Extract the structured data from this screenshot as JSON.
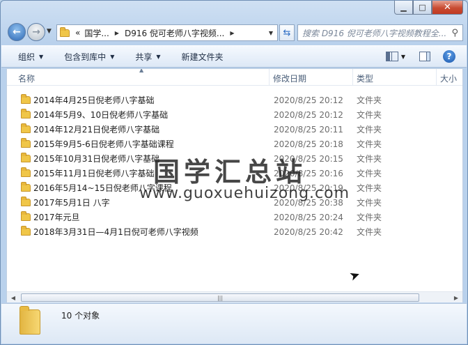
{
  "address": {
    "overflow": "«",
    "crumbs": [
      "国学...",
      "D916 倪可老师八字视频..."
    ]
  },
  "search": {
    "placeholder": "搜索 D916 倪可老师八字视频教程全..."
  },
  "toolbar": {
    "organize": "组织",
    "include_library": "包含到库中",
    "share": "共享",
    "new_folder": "新建文件夹"
  },
  "columns": {
    "name": "名称",
    "date": "修改日期",
    "type": "类型",
    "size": "大小"
  },
  "files": [
    {
      "name": "2014年4月25日倪老师八字基础",
      "date": "2020/8/25 20:12",
      "type": "文件夹"
    },
    {
      "name": "2014年5月9、10日倪老师八字基础",
      "date": "2020/8/25 20:12",
      "type": "文件夹"
    },
    {
      "name": "2014年12月21日倪老师八字基础",
      "date": "2020/8/25 20:11",
      "type": "文件夹"
    },
    {
      "name": "2015年9月5-6日倪老师八字基础课程",
      "date": "2020/8/25 20:18",
      "type": "文件夹"
    },
    {
      "name": "2015年10月31日倪老师八字基础",
      "date": "2020/8/25 20:15",
      "type": "文件夹"
    },
    {
      "name": "2015年11月1日倪老师八字基础",
      "date": "2020/8/25 20:16",
      "type": "文件夹"
    },
    {
      "name": "2016年5月14~15日倪老师八字课程",
      "date": "2020/8/25 20:19",
      "type": "文件夹"
    },
    {
      "name": "2017年5月1日 八字",
      "date": "2020/8/25 20:38",
      "type": "文件夹"
    },
    {
      "name": "2017年元旦",
      "date": "2020/8/25 20:24",
      "type": "文件夹"
    },
    {
      "name": "2018年3月31日—4月1日倪可老师八字视频",
      "date": "2020/8/25 20:42",
      "type": "文件夹"
    }
  ],
  "watermark": {
    "cn": "国学汇总站",
    "en": "www.guoxuehuizong.com"
  },
  "status": {
    "count": "10 个对象"
  }
}
